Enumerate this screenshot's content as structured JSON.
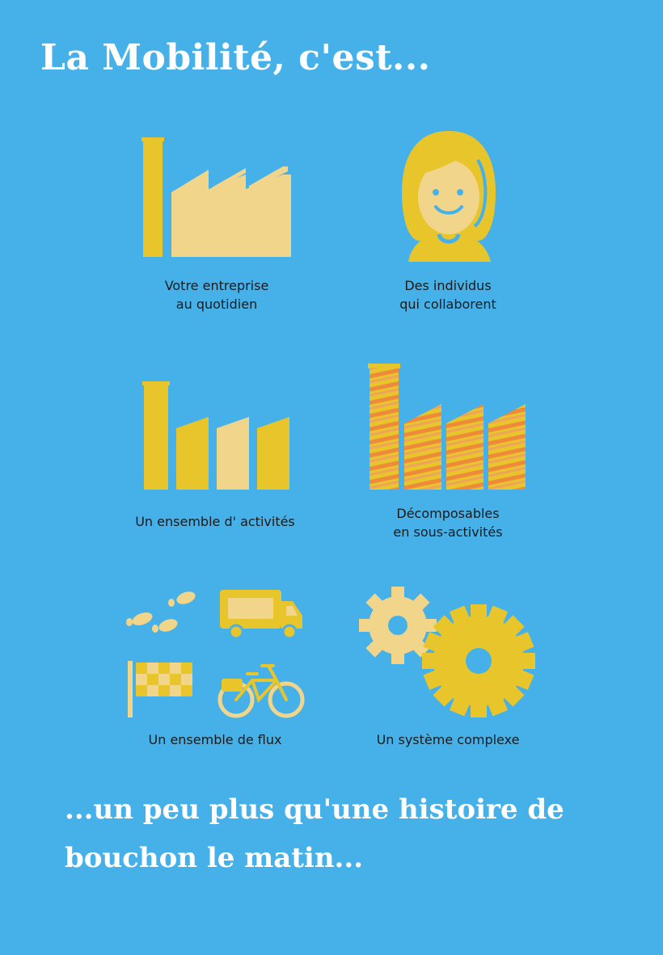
{
  "title": "La Mobilité, c'est...",
  "items": [
    {
      "line1": "Votre entreprise",
      "line2": "au quotidien",
      "icon": "factory-icon"
    },
    {
      "line1": "Des individus",
      "line2": "qui collaborent",
      "icon": "woman-icon"
    },
    {
      "line1": "Un ensemble d' activités",
      "line2": "",
      "icon": "activity-blocks-icon"
    },
    {
      "line1": "Décomposables",
      "line2": "en sous-activités",
      "icon": "striped-blocks-icon"
    },
    {
      "line1": "Un ensemble de flux",
      "line2": "",
      "icon": "flux-icons"
    },
    {
      "line1": "Un système complexe",
      "line2": "",
      "icon": "gears-icon"
    }
  ],
  "footer": {
    "line1": "...un peu plus qu'une histoire de",
    "line2": "bouchon le matin..."
  },
  "colors": {
    "background": "#46b1e9",
    "yellow": "#e7c52b",
    "light_yellow": "#f0d58a",
    "orange": "#ef8a3a",
    "text": "#1b1b1b",
    "white": "#ffffff"
  }
}
